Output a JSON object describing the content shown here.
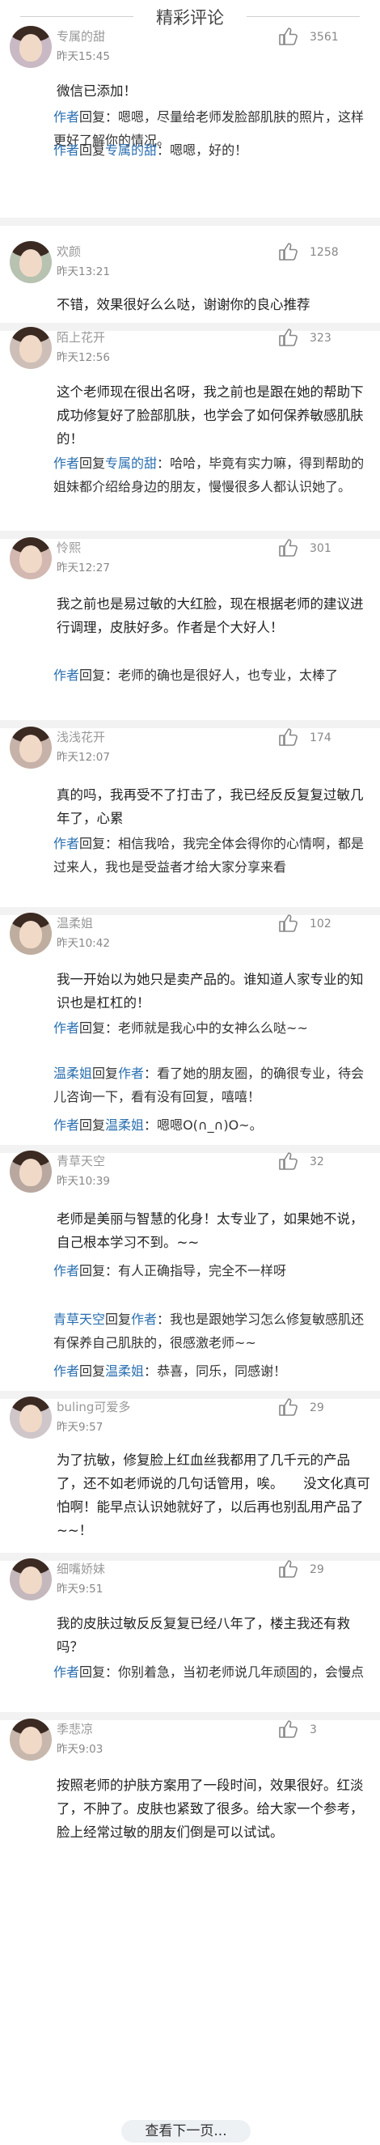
{
  "section_title": "精彩评论",
  "comments": [
    {
      "user": "专属的甜",
      "time": "昨天15:45",
      "likes": "3561",
      "body": "微信已添加！",
      "replies": [
        {
          "who": "作者",
          "to": "",
          "text": "嗯嗯，尽量给老师发脸部肌肤的照片，这样更好了解你的情况。"
        },
        {
          "who": "作者",
          "to": "专属的甜",
          "text": "嗯嗯，好的！"
        }
      ]
    },
    {
      "user": "欢颜",
      "time": "昨天13:21",
      "likes": "1258",
      "body": "不错，效果很好么么哒，谢谢你的良心推荐",
      "replies": []
    },
    {
      "user": "陌上花开",
      "time": "昨天12:56",
      "likes": "323",
      "body": "这个老师现在很出名呀，我之前也是跟在她的帮助下成功修复好了脸部肌肤，也学会了如何保养敏感肌肤的！",
      "replies": [
        {
          "who": "作者",
          "to": "专属的甜",
          "text": "哈哈，毕竟有实力嘛，得到帮助的姐妹都介绍给身边的朋友，慢慢很多人都认识她了。"
        }
      ]
    },
    {
      "user": "怜熙",
      "time": "昨天12:27",
      "likes": "301",
      "body": "我之前也是易过敏的大红脸，现在根据老师的建议进行调理，皮肤好多。作者是个大好人！",
      "replies": [
        {
          "who": "作者",
          "to": "",
          "text": "老师的确也是很好人，也专业，太棒了"
        }
      ]
    },
    {
      "user": "浅浅花开",
      "time": "昨天12:07",
      "likes": "174",
      "body": "真的吗，我再受不了打击了，我已经反反复复过敏几年了，心累",
      "replies": [
        {
          "who": "作者",
          "to": "",
          "text": "相信我哈，我完全体会得你的心情啊，都是过来人，我也是受益者才给大家分享来看"
        }
      ]
    },
    {
      "user": "温柔姐",
      "time": "昨天10:42",
      "likes": "102",
      "body": "我一开始以为她只是卖产品的。谁知道人家专业的知识也是杠杠的！",
      "replies": [
        {
          "who": "作者",
          "to": "",
          "text": "老师就是我心中的女神么么哒~~"
        },
        {
          "who": "温柔姐",
          "to": "作者",
          "text": "看了她的朋友圈，的确很专业，待会儿咨询一下，看有没有回复，嘻嘻！"
        },
        {
          "who": "作者",
          "to": "温柔姐",
          "text": "嗯嗯O(∩_∩)O~。"
        }
      ]
    },
    {
      "user": "青草天空",
      "time": "昨天10:39",
      "likes": "32",
      "body": "老师是美丽与智慧的化身！太专业了，如果她不说，自己根本学习不到。~~",
      "replies": [
        {
          "who": "作者",
          "to": "",
          "text": "有人正确指导，完全不一样呀"
        },
        {
          "who": "青草天空",
          "to": "作者",
          "text": "我也是跟她学习怎么修复敏感肌还有保养自己肌肤的，很感激老师~~"
        },
        {
          "who": "作者",
          "to": "温柔姐",
          "text": "恭喜，同乐，同感谢！"
        }
      ]
    },
    {
      "user": "buling可爱多",
      "time": "昨天9:57",
      "likes": "29",
      "body": "为了抗敏，修复脸上红血丝我都用了几千元的产品了，还不如老师说的几句话管用，唉。　　没文化真可怕啊！能早点认识她就好了，以后再也别乱用产品了~~！",
      "replies": []
    },
    {
      "user": "细嘴娇妹",
      "time": "昨天9:51",
      "likes": "29",
      "body": "我的皮肤过敏反反复复已经八年了，楼主我还有救吗？",
      "replies": [
        {
          "who": "作者",
          "to": "",
          "text": "你别着急，当初老师说几年顽固的，会慢点"
        }
      ]
    },
    {
      "user": "季悲凉",
      "time": "昨天9:03",
      "likes": "3",
      "body": "按照老师的护肤方案用了一段时间，效果很好。红淡了，不肿了。皮肤也紧致了很多。给大家一个参考，脸上经常过敏的朋友们倒是可以试试。",
      "replies": []
    }
  ],
  "reply_word": "回复",
  "colon": "：",
  "more_label": "查看下一页...",
  "colors": {
    "link": "#2a6fb0",
    "text": "#222222",
    "meta": "#999999"
  }
}
